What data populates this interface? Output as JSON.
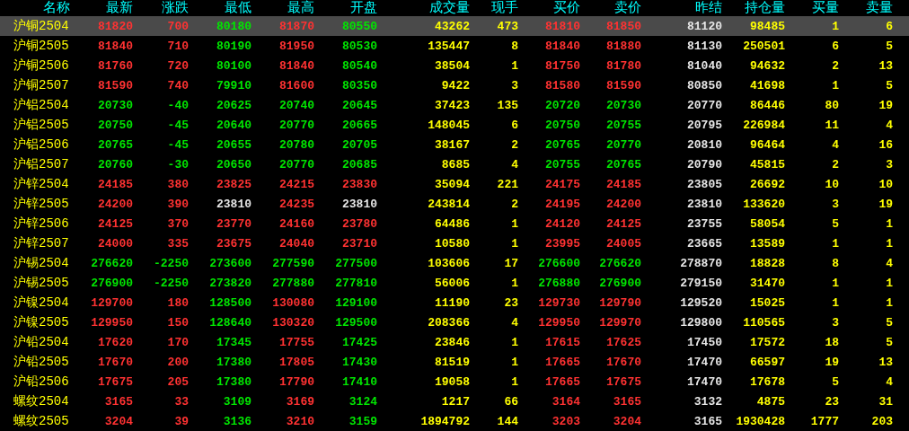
{
  "name_header": "名称",
  "columns": [
    {
      "label": "最新",
      "kind": "price"
    },
    {
      "label": "涨跌",
      "kind": "price"
    },
    {
      "label": "最低",
      "kind": "price"
    },
    {
      "label": "最高",
      "kind": "price"
    },
    {
      "label": "开盘",
      "kind": "price"
    },
    {
      "label": "成交量",
      "kind": "quantity"
    },
    {
      "label": "现手",
      "kind": "quantity"
    },
    {
      "label": "买价",
      "kind": "price"
    },
    {
      "label": "卖价",
      "kind": "price"
    },
    {
      "label": "昨结",
      "kind": "reference"
    },
    {
      "label": "持仓量",
      "kind": "quantity"
    },
    {
      "label": "买量",
      "kind": "quantity"
    },
    {
      "label": "卖量",
      "kind": "quantity"
    }
  ],
  "rows": [
    {
      "name": "沪铜2504",
      "selected": true,
      "cells": [
        {
          "text": "81820",
          "color": "#ff3232"
        },
        {
          "text": "700",
          "color": "#ff3232"
        },
        {
          "text": "80180",
          "color": "#00e600"
        },
        {
          "text": "81870",
          "color": "#ff3232"
        },
        {
          "text": "80550",
          "color": "#00e600"
        },
        "43262",
        "473",
        {
          "text": "81810",
          "color": "#ff3232"
        },
        {
          "text": "81850",
          "color": "#ff3232"
        },
        "81120",
        "98485",
        "1",
        "6"
      ]
    },
    {
      "name": "沪铜2505",
      "selected": false,
      "cells": [
        {
          "text": "81840",
          "color": "#ff3232"
        },
        {
          "text": "710",
          "color": "#ff3232"
        },
        {
          "text": "80190",
          "color": "#00e600"
        },
        {
          "text": "81950",
          "color": "#ff3232"
        },
        {
          "text": "80530",
          "color": "#00e600"
        },
        "135447",
        "8",
        {
          "text": "81840",
          "color": "#ff3232"
        },
        {
          "text": "81880",
          "color": "#ff3232"
        },
        "81130",
        "250501",
        "6",
        "5"
      ]
    },
    {
      "name": "沪铜2506",
      "selected": false,
      "cells": [
        {
          "text": "81760",
          "color": "#ff3232"
        },
        {
          "text": "720",
          "color": "#ff3232"
        },
        {
          "text": "80100",
          "color": "#00e600"
        },
        {
          "text": "81840",
          "color": "#ff3232"
        },
        {
          "text": "80540",
          "color": "#00e600"
        },
        "38504",
        "1",
        {
          "text": "81750",
          "color": "#ff3232"
        },
        {
          "text": "81780",
          "color": "#ff3232"
        },
        "81040",
        "94632",
        "2",
        "13"
      ]
    },
    {
      "name": "沪铜2507",
      "selected": false,
      "cells": [
        {
          "text": "81590",
          "color": "#ff3232"
        },
        {
          "text": "740",
          "color": "#ff3232"
        },
        {
          "text": "79910",
          "color": "#00e600"
        },
        {
          "text": "81600",
          "color": "#ff3232"
        },
        {
          "text": "80350",
          "color": "#00e600"
        },
        "9422",
        "3",
        {
          "text": "81580",
          "color": "#ff3232"
        },
        {
          "text": "81590",
          "color": "#ff3232"
        },
        "80850",
        "41698",
        "1",
        "5"
      ]
    },
    {
      "name": "沪铝2504",
      "selected": false,
      "cells": [
        {
          "text": "20730",
          "color": "#00e600"
        },
        {
          "text": "-40",
          "color": "#00e600"
        },
        {
          "text": "20625",
          "color": "#00e600"
        },
        {
          "text": "20740",
          "color": "#00e600"
        },
        {
          "text": "20645",
          "color": "#00e600"
        },
        "37423",
        "135",
        {
          "text": "20720",
          "color": "#00e600"
        },
        {
          "text": "20730",
          "color": "#00e600"
        },
        "20770",
        "86446",
        "80",
        "19"
      ]
    },
    {
      "name": "沪铝2505",
      "selected": false,
      "cells": [
        {
          "text": "20750",
          "color": "#00e600"
        },
        {
          "text": "-45",
          "color": "#00e600"
        },
        {
          "text": "20640",
          "color": "#00e600"
        },
        {
          "text": "20770",
          "color": "#00e600"
        },
        {
          "text": "20665",
          "color": "#00e600"
        },
        "148045",
        "6",
        {
          "text": "20750",
          "color": "#00e600"
        },
        {
          "text": "20755",
          "color": "#00e600"
        },
        "20795",
        "226984",
        "11",
        "4"
      ]
    },
    {
      "name": "沪铝2506",
      "selected": false,
      "cells": [
        {
          "text": "20765",
          "color": "#00e600"
        },
        {
          "text": "-45",
          "color": "#00e600"
        },
        {
          "text": "20655",
          "color": "#00e600"
        },
        {
          "text": "20780",
          "color": "#00e600"
        },
        {
          "text": "20705",
          "color": "#00e600"
        },
        "38167",
        "2",
        {
          "text": "20765",
          "color": "#00e600"
        },
        {
          "text": "20770",
          "color": "#00e600"
        },
        "20810",
        "96464",
        "4",
        "16"
      ]
    },
    {
      "name": "沪铝2507",
      "selected": false,
      "cells": [
        {
          "text": "20760",
          "color": "#00e600"
        },
        {
          "text": "-30",
          "color": "#00e600"
        },
        {
          "text": "20650",
          "color": "#00e600"
        },
        {
          "text": "20770",
          "color": "#00e600"
        },
        {
          "text": "20685",
          "color": "#00e600"
        },
        "8685",
        "4",
        {
          "text": "20755",
          "color": "#00e600"
        },
        {
          "text": "20765",
          "color": "#00e600"
        },
        "20790",
        "45815",
        "2",
        "3"
      ]
    },
    {
      "name": "沪锌2504",
      "selected": false,
      "cells": [
        {
          "text": "24185",
          "color": "#ff3232"
        },
        {
          "text": "380",
          "color": "#ff3232"
        },
        {
          "text": "23825",
          "color": "#ff3232"
        },
        {
          "text": "24215",
          "color": "#ff3232"
        },
        {
          "text": "23830",
          "color": "#ff3232"
        },
        "35094",
        "221",
        {
          "text": "24175",
          "color": "#ff3232"
        },
        {
          "text": "24185",
          "color": "#ff3232"
        },
        "23805",
        "26692",
        "10",
        "10"
      ]
    },
    {
      "name": "沪锌2505",
      "selected": false,
      "cells": [
        {
          "text": "24200",
          "color": "#ff3232"
        },
        {
          "text": "390",
          "color": "#ff3232"
        },
        {
          "text": "23810",
          "color": "#e6e6e6"
        },
        {
          "text": "24235",
          "color": "#ff3232"
        },
        {
          "text": "23810",
          "color": "#e6e6e6"
        },
        "243814",
        "2",
        {
          "text": "24195",
          "color": "#ff3232"
        },
        {
          "text": "24200",
          "color": "#ff3232"
        },
        "23810",
        "133620",
        "3",
        "19"
      ]
    },
    {
      "name": "沪锌2506",
      "selected": false,
      "cells": [
        {
          "text": "24125",
          "color": "#ff3232"
        },
        {
          "text": "370",
          "color": "#ff3232"
        },
        {
          "text": "23770",
          "color": "#ff3232"
        },
        {
          "text": "24160",
          "color": "#ff3232"
        },
        {
          "text": "23780",
          "color": "#ff3232"
        },
        "64486",
        "1",
        {
          "text": "24120",
          "color": "#ff3232"
        },
        {
          "text": "24125",
          "color": "#ff3232"
        },
        "23755",
        "58054",
        "5",
        "1"
      ]
    },
    {
      "name": "沪锌2507",
      "selected": false,
      "cells": [
        {
          "text": "24000",
          "color": "#ff3232"
        },
        {
          "text": "335",
          "color": "#ff3232"
        },
        {
          "text": "23675",
          "color": "#ff3232"
        },
        {
          "text": "24040",
          "color": "#ff3232"
        },
        {
          "text": "23710",
          "color": "#ff3232"
        },
        "10580",
        "1",
        {
          "text": "23995",
          "color": "#ff3232"
        },
        {
          "text": "24005",
          "color": "#ff3232"
        },
        "23665",
        "13589",
        "1",
        "1"
      ]
    },
    {
      "name": "沪锡2504",
      "selected": false,
      "cells": [
        {
          "text": "276620",
          "color": "#00e600"
        },
        {
          "text": "-2250",
          "color": "#00e600"
        },
        {
          "text": "273600",
          "color": "#00e600"
        },
        {
          "text": "277590",
          "color": "#00e600"
        },
        {
          "text": "277500",
          "color": "#00e600"
        },
        "103606",
        "17",
        {
          "text": "276600",
          "color": "#00e600"
        },
        {
          "text": "276620",
          "color": "#00e600"
        },
        "278870",
        "18828",
        "8",
        "4"
      ]
    },
    {
      "name": "沪锡2505",
      "selected": false,
      "cells": [
        {
          "text": "276900",
          "color": "#00e600"
        },
        {
          "text": "-2250",
          "color": "#00e600"
        },
        {
          "text": "273820",
          "color": "#00e600"
        },
        {
          "text": "277880",
          "color": "#00e600"
        },
        {
          "text": "277810",
          "color": "#00e600"
        },
        "56006",
        "1",
        {
          "text": "276880",
          "color": "#00e600"
        },
        {
          "text": "276900",
          "color": "#00e600"
        },
        "279150",
        "31470",
        "1",
        "1"
      ]
    },
    {
      "name": "沪镍2504",
      "selected": false,
      "cells": [
        {
          "text": "129700",
          "color": "#ff3232"
        },
        {
          "text": "180",
          "color": "#ff3232"
        },
        {
          "text": "128500",
          "color": "#00e600"
        },
        {
          "text": "130080",
          "color": "#ff3232"
        },
        {
          "text": "129100",
          "color": "#00e600"
        },
        "11190",
        "23",
        {
          "text": "129730",
          "color": "#ff3232"
        },
        {
          "text": "129790",
          "color": "#ff3232"
        },
        "129520",
        "15025",
        "1",
        "1"
      ]
    },
    {
      "name": "沪镍2505",
      "selected": false,
      "cells": [
        {
          "text": "129950",
          "color": "#ff3232"
        },
        {
          "text": "150",
          "color": "#ff3232"
        },
        {
          "text": "128640",
          "color": "#00e600"
        },
        {
          "text": "130320",
          "color": "#ff3232"
        },
        {
          "text": "129500",
          "color": "#00e600"
        },
        "208366",
        "4",
        {
          "text": "129950",
          "color": "#ff3232"
        },
        {
          "text": "129970",
          "color": "#ff3232"
        },
        "129800",
        "110565",
        "3",
        "5"
      ]
    },
    {
      "name": "沪铅2504",
      "selected": false,
      "cells": [
        {
          "text": "17620",
          "color": "#ff3232"
        },
        {
          "text": "170",
          "color": "#ff3232"
        },
        {
          "text": "17345",
          "color": "#00e600"
        },
        {
          "text": "17755",
          "color": "#ff3232"
        },
        {
          "text": "17425",
          "color": "#00e600"
        },
        "23846",
        "1",
        {
          "text": "17615",
          "color": "#ff3232"
        },
        {
          "text": "17625",
          "color": "#ff3232"
        },
        "17450",
        "17572",
        "18",
        "5"
      ]
    },
    {
      "name": "沪铅2505",
      "selected": false,
      "cells": [
        {
          "text": "17670",
          "color": "#ff3232"
        },
        {
          "text": "200",
          "color": "#ff3232"
        },
        {
          "text": "17380",
          "color": "#00e600"
        },
        {
          "text": "17805",
          "color": "#ff3232"
        },
        {
          "text": "17430",
          "color": "#00e600"
        },
        "81519",
        "1",
        {
          "text": "17665",
          "color": "#ff3232"
        },
        {
          "text": "17670",
          "color": "#ff3232"
        },
        "17470",
        "66597",
        "19",
        "13"
      ]
    },
    {
      "name": "沪铅2506",
      "selected": false,
      "cells": [
        {
          "text": "17675",
          "color": "#ff3232"
        },
        {
          "text": "205",
          "color": "#ff3232"
        },
        {
          "text": "17380",
          "color": "#00e600"
        },
        {
          "text": "17790",
          "color": "#ff3232"
        },
        {
          "text": "17410",
          "color": "#00e600"
        },
        "19058",
        "1",
        {
          "text": "17665",
          "color": "#ff3232"
        },
        {
          "text": "17675",
          "color": "#ff3232"
        },
        "17470",
        "17678",
        "5",
        "4"
      ]
    },
    {
      "name": "螺纹2504",
      "selected": false,
      "cells": [
        {
          "text": "3165",
          "color": "#ff3232"
        },
        {
          "text": "33",
          "color": "#ff3232"
        },
        {
          "text": "3109",
          "color": "#00e600"
        },
        {
          "text": "3169",
          "color": "#ff3232"
        },
        {
          "text": "3124",
          "color": "#00e600"
        },
        "1217",
        "66",
        {
          "text": "3164",
          "color": "#ff3232"
        },
        {
          "text": "3165",
          "color": "#ff3232"
        },
        "3132",
        "4875",
        "23",
        "31"
      ]
    },
    {
      "name": "螺纹2505",
      "selected": false,
      "cells": [
        {
          "text": "3204",
          "color": "#ff3232"
        },
        {
          "text": "39",
          "color": "#ff3232"
        },
        {
          "text": "3136",
          "color": "#00e600"
        },
        {
          "text": "3210",
          "color": "#ff3232"
        },
        {
          "text": "3159",
          "color": "#00e600"
        },
        "1894792",
        "144",
        {
          "text": "3203",
          "color": "#ff3232"
        },
        {
          "text": "3204",
          "color": "#ff3232"
        },
        "3165",
        "1930428",
        "1777",
        "203"
      ]
    }
  ]
}
